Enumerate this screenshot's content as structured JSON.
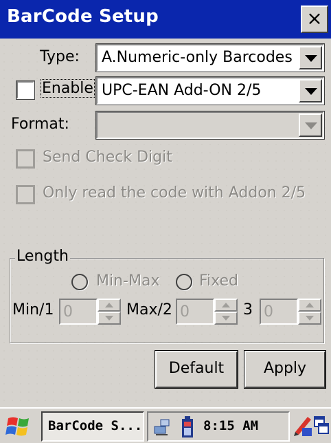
{
  "window": {
    "title": "BarCode Setup",
    "close_label": "×"
  },
  "form": {
    "type_label": "Type:",
    "type_value": "A.Numeric-only Barcodes",
    "enable_label": "Enable",
    "enable_checked": false,
    "enable_value": "UPC-EAN Add-ON 2/5",
    "format_label": "Format:",
    "format_value": "",
    "send_check_digit_label": "Send Check Digit",
    "send_check_digit_checked": false,
    "only_read_addon_label": "Only read the code with Addon 2/5",
    "only_read_addon_checked": false
  },
  "length": {
    "group_label": "Length",
    "radio_minmax_label": "Min-Max",
    "radio_fixed_label": "Fixed",
    "min_label": "Min/1",
    "min_value": "0",
    "max_label": "Max/2",
    "max_value": "0",
    "third_label": "3",
    "third_value": "0"
  },
  "buttons": {
    "default_label": "Default",
    "apply_label": "Apply"
  },
  "taskbar": {
    "start_icon": "windows-flag-icon",
    "task_label": "BarCode S...",
    "clock": "8:15 AM",
    "tray_icons": [
      "network-icon",
      "battery-icon",
      "input-panel-icon",
      "switch-windows-icon"
    ]
  },
  "colors": {
    "titlebar": "#0a26ad",
    "face": "#d6d3ce",
    "disabled_text": "#8c8a86"
  }
}
